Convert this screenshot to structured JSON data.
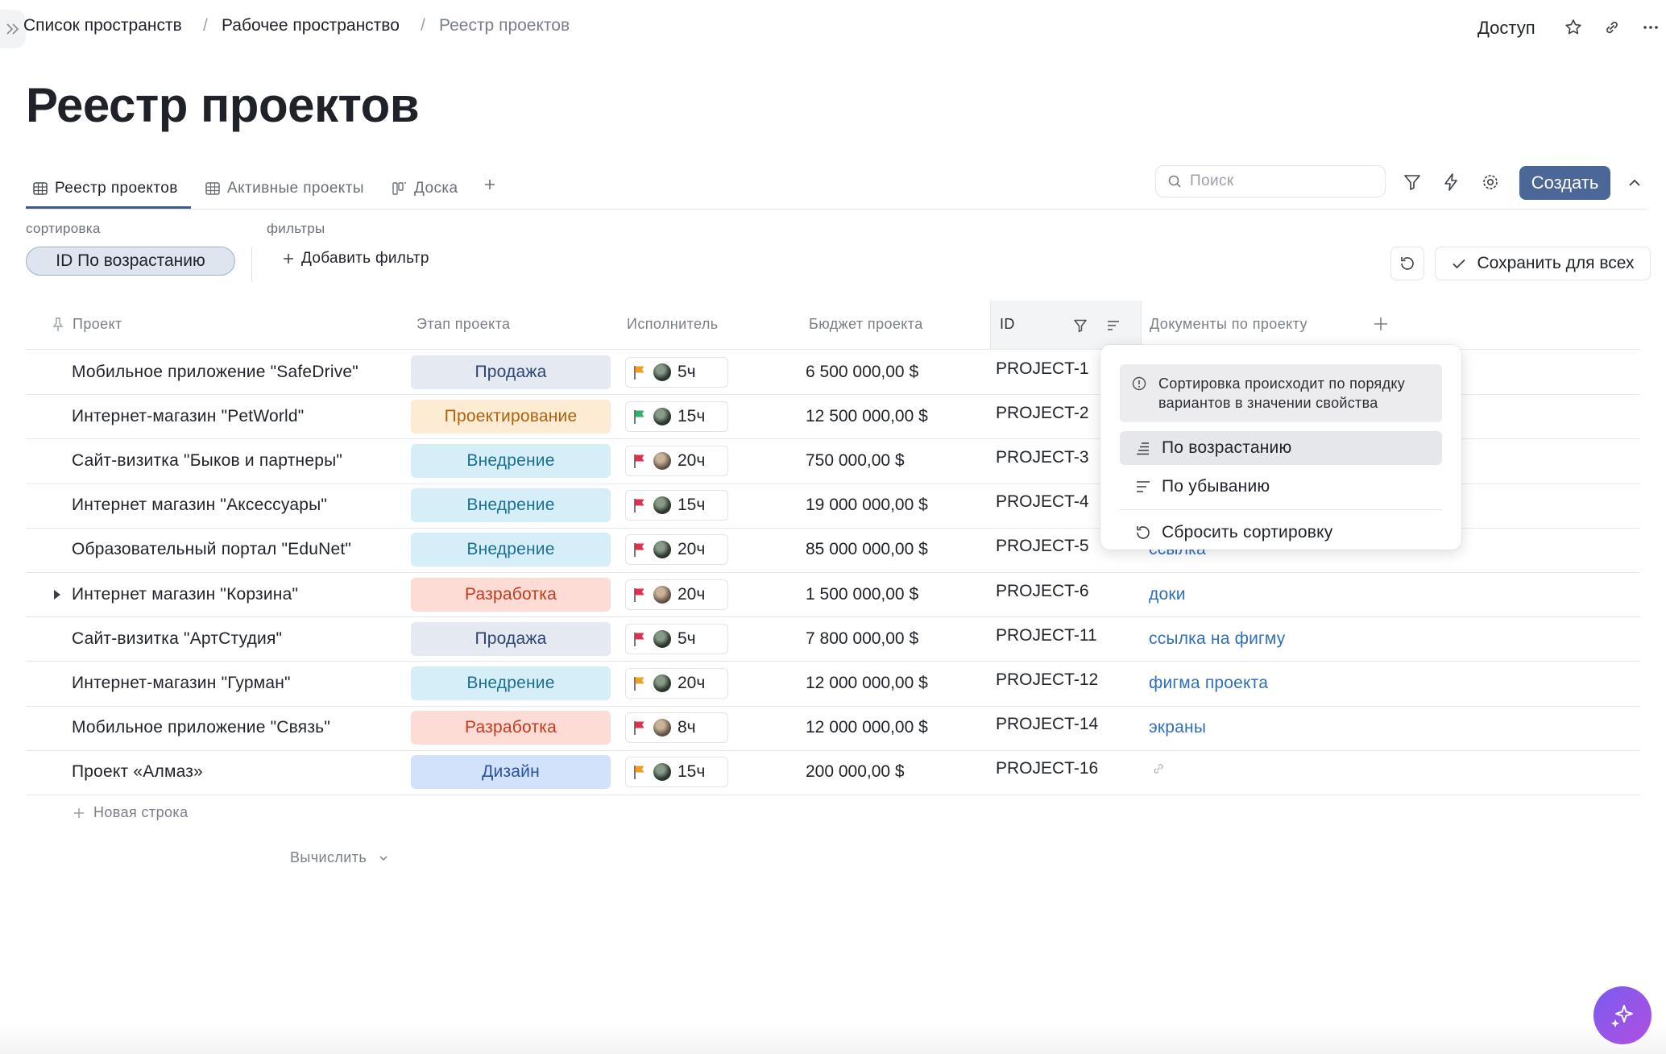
{
  "breadcrumb": [
    "Список пространств",
    "Рабочее пространство",
    "Реестр проектов"
  ],
  "top_actions": {
    "access": "Доступ"
  },
  "page_title": "Реестр проектов",
  "tabs": [
    {
      "label": "Реестр проектов",
      "icon": "table-icon",
      "active": true
    },
    {
      "label": "Активные проекты",
      "icon": "table-icon",
      "active": false
    },
    {
      "label": "Доска",
      "icon": "board-icon",
      "active": false
    }
  ],
  "search": {
    "placeholder": "Поиск"
  },
  "create_label": "Создать",
  "sort": {
    "label": "сортировка",
    "pill": "ID По возрастанию"
  },
  "filters": {
    "label": "фильтры",
    "add": "Добавить фильтр"
  },
  "save_all": "Сохранить для всех",
  "columns": [
    "Проект",
    "Этап проекта",
    "Исполнитель",
    "Бюджет проекта",
    "ID",
    "Документы по проекту"
  ],
  "rows": [
    {
      "name": "Мобильное приложение \"SafeDrive\"",
      "stage": "Продажа",
      "flag": "#f0a020",
      "hours": "5ч",
      "budget": "6 500 000,00 $",
      "id": "PROJECT-1",
      "doc": ""
    },
    {
      "name": "Интернет-магазин \"PetWorld\"",
      "stage": "Проектирование",
      "flag": "#2fb36a",
      "hours": "15ч",
      "budget": "12 500 000,00 $",
      "id": "PROJECT-2",
      "doc": ""
    },
    {
      "name": "Сайт-визитка \"Быков и партнеры\"",
      "stage": "Внедрение",
      "flag": "#e0304e",
      "hours": "20ч",
      "budget": "750 000,00 $",
      "id": "PROJECT-3",
      "doc": ""
    },
    {
      "name": "Интернет магазин \"Аксессуары\"",
      "stage": "Внедрение",
      "flag": "#e0304e",
      "hours": "15ч",
      "budget": "19 000 000,00 $",
      "id": "PROJECT-4",
      "doc": ""
    },
    {
      "name": "Образовательный портал \"EduNet\"",
      "stage": "Внедрение",
      "flag": "#e0304e",
      "hours": "20ч",
      "budget": "85 000 000,00 $",
      "id": "PROJECT-5",
      "doc": "ссылка"
    },
    {
      "name": "Интернет магазин \"Корзина\"",
      "stage": "Разработка",
      "flag": "#e0304e",
      "hours": "20ч",
      "budget": "1 500 000,00 $",
      "id": "PROJECT-6",
      "doc": "доки"
    },
    {
      "name": "Сайт-визитка \"АртСтудия\"",
      "stage": "Продажа",
      "flag": "#e0304e",
      "hours": "5ч",
      "budget": "7 800 000,00 $",
      "id": "PROJECT-11",
      "doc": "ссылка на фигму"
    },
    {
      "name": "Интернет-магазин \"Гурман\"",
      "stage": "Внедрение",
      "flag": "#f0a020",
      "hours": "20ч",
      "budget": "12 000 000,00 $",
      "id": "PROJECT-12",
      "doc": "фигма проекта"
    },
    {
      "name": "Мобильное приложение \"Связь\"",
      "stage": "Разработка",
      "flag": "#e0304e",
      "hours": "8ч",
      "budget": "12 000 000,00 $",
      "id": "PROJECT-14",
      "doc": "экраны"
    },
    {
      "name": "Проект «Алмаз»",
      "stage": "Дизайн",
      "flag": "#f0a020",
      "hours": "15ч",
      "budget": "200 000,00 $",
      "id": "PROJECT-16",
      "doc": ""
    }
  ],
  "stage_colors": {
    "Продажа": {
      "bg": "#e4e9f2",
      "fg": "#2d4470"
    },
    "Проектирование": {
      "bg": "#fdebd3",
      "fg": "#b0620a"
    },
    "Внедрение": {
      "bg": "#d6eef8",
      "fg": "#1a6f93"
    },
    "Разработка": {
      "bg": "#fddcd5",
      "fg": "#c23a1c"
    },
    "Дизайн": {
      "bg": "#d3e2fb",
      "fg": "#2952a3"
    }
  },
  "new_row": "Новая строка",
  "calculate": "Вычислить",
  "sort_menu": {
    "info": "Сортировка происходит по порядку\nвариантов в значении свойства",
    "ascending": "По возрастанию",
    "descending": "По убыванию",
    "reset": "Сбросить сортировку"
  }
}
